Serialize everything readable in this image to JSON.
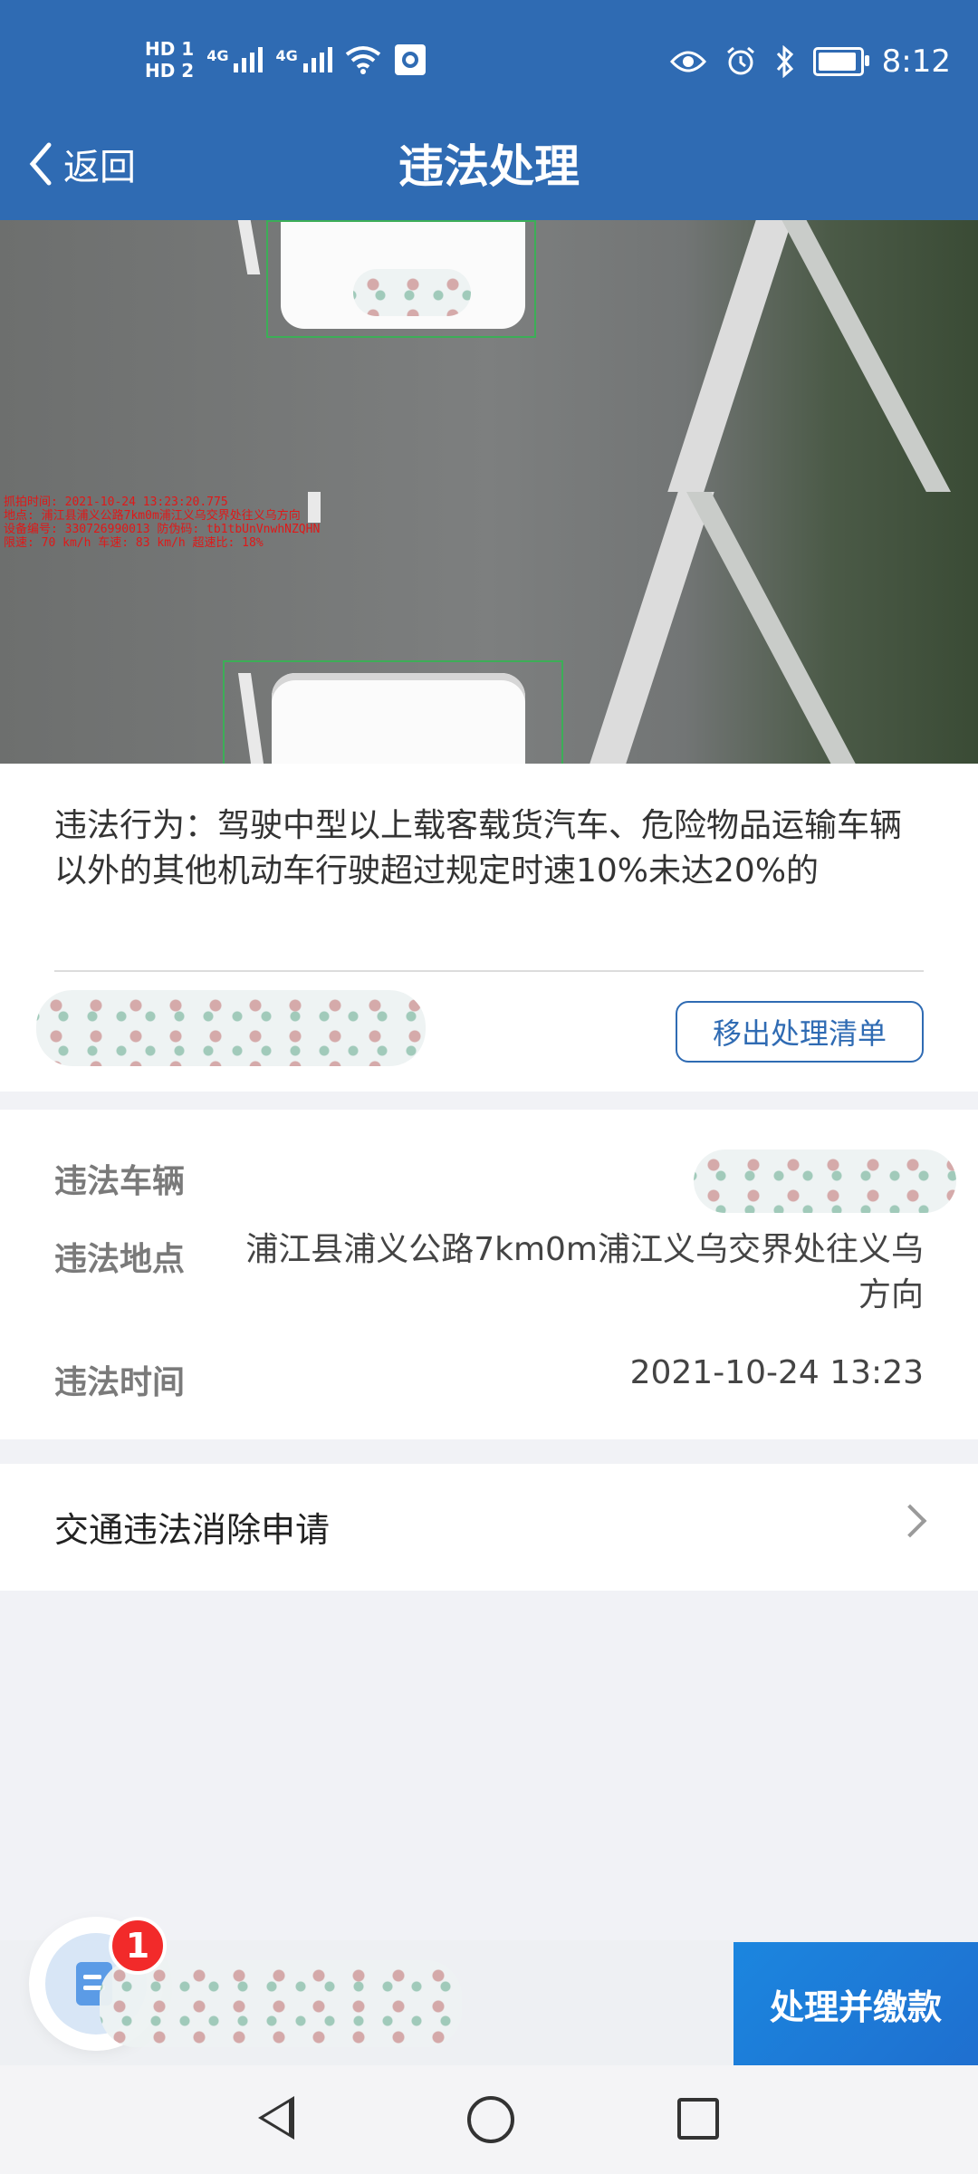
{
  "status_bar": {
    "hd1": "HD 1",
    "hd2": "HD 2",
    "net1": "4G",
    "net2": "4G",
    "time": "8:12"
  },
  "header": {
    "back_label": "返回",
    "title": "违法处理"
  },
  "photo_overlay": {
    "line1": "抓拍时间: 2021-10-24 13:23:20.775",
    "line2": "地点: 浦江县浦义公路7km0m浦江义乌交界处往义乌方向",
    "line3": "设备编号: 330726990013 防伪码: tb1tbUnVnwhNZQHN",
    "line4": "限速: 70 km/h 车速: 83 km/h 超速比: 18%"
  },
  "violation": {
    "text": "违法行为：驾驶中型以上载客载货汽车、危险物品运输车辆以外的其他机动车行驶超过规定时速10%未达20%的",
    "remove_button": "移出处理清单"
  },
  "details": {
    "vehicle_label": "违法车辆",
    "location_label": "违法地点",
    "location_value": "浦江县浦义公路7km0m浦江义乌交界处往义乌方向",
    "time_label": "违法时间",
    "time_value": "2021-10-24 13:23"
  },
  "erase_request": {
    "label": "交通违法消除申请"
  },
  "bottom": {
    "badge_count": "1",
    "pay_button": "处理并缴款"
  }
}
